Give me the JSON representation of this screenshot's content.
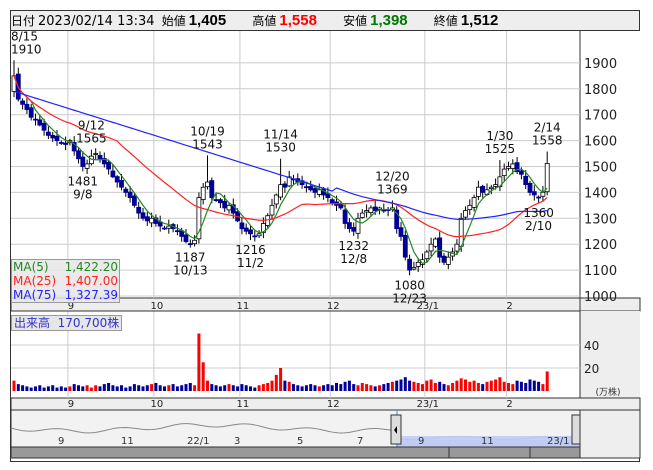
{
  "header": {
    "date_label": "日付",
    "datetime": "2023/02/14 13:34",
    "open_label": "始値",
    "open": "1,405",
    "high_label": "高値",
    "high": "1,558",
    "low_label": "安値",
    "low": "1,398",
    "close_label": "終値",
    "close": "1,512"
  },
  "colors": {
    "up": "#ffffff",
    "down": "#000099",
    "ma5": "#228822",
    "ma25": "#ff2222",
    "ma75": "#2222ff",
    "vol_up": "#ff0000",
    "vol_down": "#000099",
    "high": "#ff0000",
    "low": "#007700"
  },
  "legend": {
    "ma5_label": "MA(5)",
    "ma5": "1,422.20",
    "ma25_label": "MA(25)",
    "ma25": "1,407.00",
    "ma75_label": "MA(75)",
    "ma75": "1,327.39"
  },
  "volume_label": {
    "label": "出来高",
    "value": "170,700株",
    "unit": "(万株)"
  },
  "chart_data": {
    "type": "candlestick",
    "ylim": [
      1000,
      1950
    ],
    "yticks": [
      1000,
      1100,
      1200,
      1300,
      1400,
      1500,
      1600,
      1700,
      1800,
      1900
    ],
    "xticks": [
      {
        "label": "9",
        "index": 13
      },
      {
        "label": "10",
        "index": 33
      },
      {
        "label": "11",
        "index": 53
      },
      {
        "label": "12",
        "index": 74
      },
      {
        "label": "23/1",
        "index": 96
      },
      {
        "label": "2",
        "index": 115
      }
    ],
    "closes": [
      1850,
      1760,
      1740,
      1720,
      1690,
      1680,
      1660,
      1640,
      1620,
      1610,
      1600,
      1590,
      1585,
      1600,
      1560,
      1530,
      1500,
      1510,
      1540,
      1550,
      1530,
      1510,
      1490,
      1460,
      1440,
      1420,
      1400,
      1380,
      1350,
      1320,
      1300,
      1290,
      1300,
      1280,
      1270,
      1260,
      1270,
      1260,
      1250,
      1230,
      1210,
      1200,
      1215,
      1380,
      1420,
      1440,
      1380,
      1370,
      1360,
      1340,
      1350,
      1320,
      1290,
      1260,
      1250,
      1240,
      1230,
      1240,
      1280,
      1310,
      1350,
      1390,
      1430,
      1420,
      1460,
      1450,
      1440,
      1430,
      1420,
      1410,
      1400,
      1410,
      1390,
      1380,
      1360,
      1350,
      1340,
      1280,
      1260,
      1250,
      1300,
      1320,
      1330,
      1340,
      1330,
      1340,
      1330,
      1330,
      1340,
      1260,
      1230,
      1150,
      1100,
      1110,
      1130,
      1140,
      1170,
      1200,
      1220,
      1150,
      1130,
      1150,
      1170,
      1200,
      1300,
      1330,
      1350,
      1380,
      1420,
      1400,
      1410,
      1420,
      1430,
      1460,
      1490,
      1500,
      1510,
      1480,
      1470,
      1430,
      1400,
      1390,
      1380,
      1400,
      1512
    ],
    "volumes": [
      9,
      6,
      5,
      4,
      3,
      4,
      5,
      3,
      4,
      5,
      3,
      4,
      3,
      4,
      6,
      5,
      4,
      5,
      3,
      5,
      4,
      6,
      7,
      5,
      4,
      5,
      3,
      4,
      6,
      5,
      4,
      5,
      6,
      7,
      5,
      4,
      5,
      6,
      4,
      5,
      6,
      7,
      5,
      50,
      25,
      9,
      6,
      5,
      4,
      5,
      6,
      5,
      4,
      6,
      5,
      4,
      3,
      5,
      6,
      7,
      9,
      14,
      20,
      9,
      8,
      6,
      5,
      4,
      5,
      6,
      5,
      4,
      5,
      6,
      5,
      7,
      6,
      8,
      9,
      6,
      5,
      7,
      6,
      5,
      4,
      5,
      6,
      7,
      8,
      9,
      10,
      12,
      9,
      8,
      7,
      6,
      9,
      10,
      7,
      8,
      6,
      5,
      7,
      9,
      11,
      10,
      8,
      9,
      7,
      6,
      8,
      9,
      10,
      12,
      8,
      7,
      6,
      9,
      8,
      7,
      10,
      9,
      8,
      6,
      17
    ],
    "annotations": [
      {
        "date": "8/15",
        "price": "1910",
        "index": 0,
        "pos": "above"
      },
      {
        "date": "9/12",
        "price": "1565",
        "index": 18,
        "pos": "above"
      },
      {
        "date": "9/8",
        "price": "1481",
        "index": 16,
        "pos": "below"
      },
      {
        "date": "10/19",
        "price": "1543",
        "index": 45,
        "pos": "above"
      },
      {
        "date": "10/13",
        "price": "1187",
        "index": 41,
        "pos": "below"
      },
      {
        "date": "11/14",
        "price": "1530",
        "index": 62,
        "pos": "above"
      },
      {
        "date": "11/2",
        "price": "1216",
        "index": 55,
        "pos": "below"
      },
      {
        "date": "12/20",
        "price": "1369",
        "index": 88,
        "pos": "above"
      },
      {
        "date": "12/8",
        "price": "1232",
        "index": 79,
        "pos": "below"
      },
      {
        "date": "12/23",
        "price": "1080",
        "index": 92,
        "pos": "below"
      },
      {
        "date": "1/30",
        "price": "1525",
        "index": 113,
        "pos": "above"
      },
      {
        "date": "2/14",
        "price": "1558",
        "index": 124,
        "pos": "above"
      },
      {
        "date": "2/10",
        "price": "1360",
        "index": 122,
        "pos": "below"
      }
    ],
    "volume_ticks": [
      20,
      40
    ],
    "navigator_ticks": [
      "9",
      "11",
      "22/1",
      "3",
      "5",
      "7",
      "9",
      "11",
      "23/1"
    ]
  }
}
